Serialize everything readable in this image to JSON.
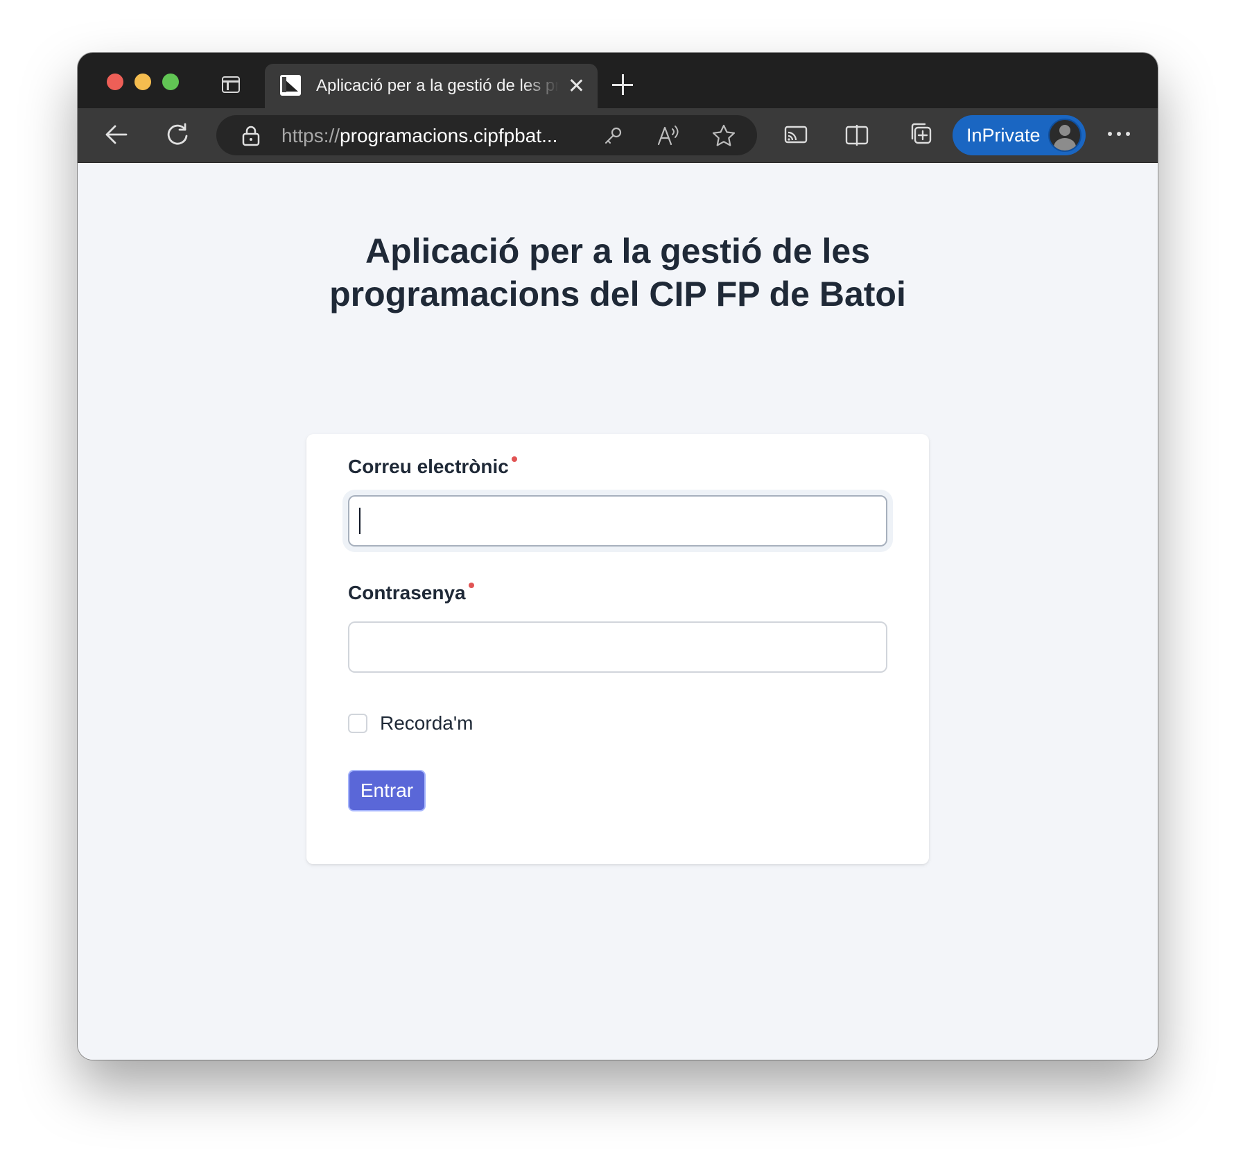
{
  "browser": {
    "tab": {
      "title": "Aplicació per a la gestió de les programacions del CIP FP de Batoi"
    },
    "address": {
      "scheme": "https://",
      "host": "programacions.cipfpbat..."
    },
    "inprivate_label": "InPrivate"
  },
  "page": {
    "title_line1": "Aplicació per a la gestió de les",
    "title_line2": "programacions del CIP FP de Batoi"
  },
  "form": {
    "email_label": "Correu electrònic",
    "email_value": "",
    "password_label": "Contrasenya",
    "password_value": "",
    "remember_label": "Recorda'm",
    "remember_checked": false,
    "submit_label": "Entrar"
  },
  "colors": {
    "required_marker": "#e15454",
    "submit_button": "#5a67d8",
    "inprivate": "#1a66c2"
  }
}
